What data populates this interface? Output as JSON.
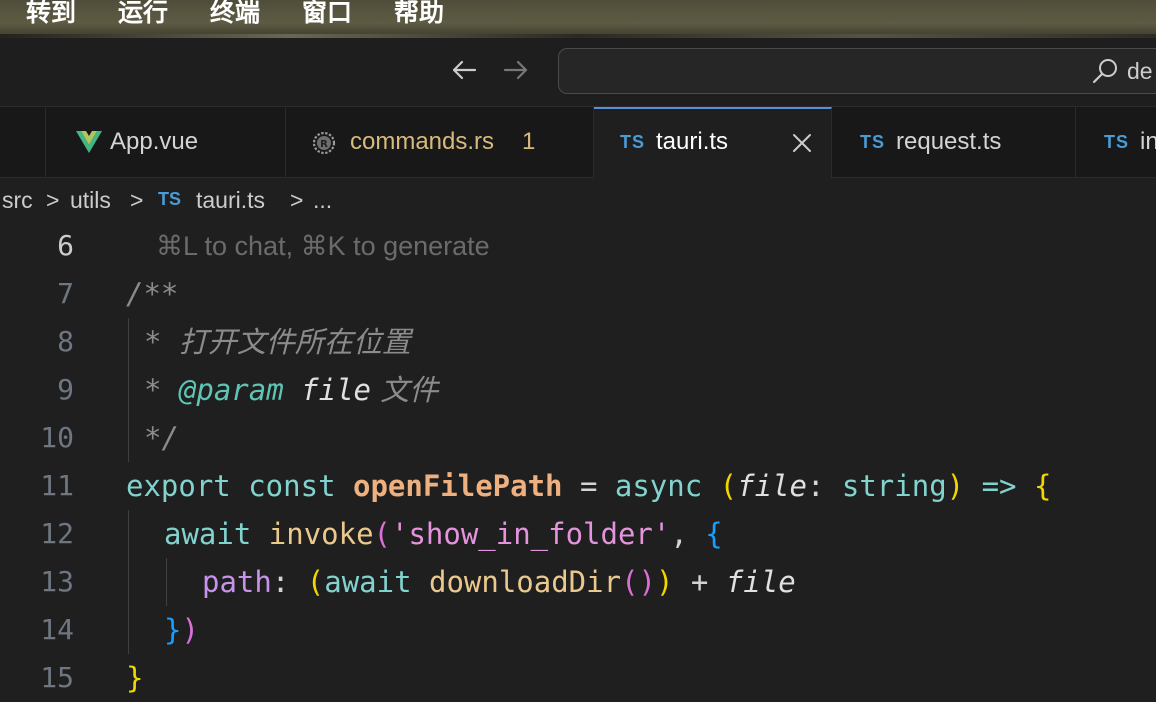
{
  "menu": {
    "items": [
      "转到",
      "运行",
      "终端",
      "窗口",
      "帮助"
    ]
  },
  "titlebar": {
    "search_text": "de"
  },
  "tabs": [
    {
      "label": "App.vue",
      "icon": "vue-icon",
      "badge": ""
    },
    {
      "label": "commands.rs",
      "icon": "rust-icon",
      "badge": "1"
    },
    {
      "label": "tauri.ts",
      "icon": "TS",
      "badge": "",
      "active": true
    },
    {
      "label": "request.ts",
      "icon": "TS",
      "badge": ""
    },
    {
      "label": "in",
      "icon": "TS",
      "badge": ""
    }
  ],
  "breadcrumb": {
    "parts": [
      "src",
      "utils",
      "tauri.ts",
      "..."
    ],
    "ts_label": "TS",
    "sep": ">"
  },
  "editor": {
    "hint": "⌘L to chat, ⌘K to generate",
    "line_numbers": [
      "6",
      "7",
      "8",
      "9",
      "10",
      "11",
      "12",
      "13",
      "14",
      "15"
    ],
    "lines": {
      "l7": "/**",
      "l8_star": "* ",
      "l8_text": "打开文件所在位置",
      "l9_star": "* ",
      "l9_tag": "@param",
      "l9_param": " file",
      "l9_text": " 文件",
      "l10": "*/",
      "l11_export": "export",
      "l11_const": " const ",
      "l11_name": "openFilePath",
      "l11_eq": " = ",
      "l11_async": "async",
      "l11_open": " (",
      "l11_param": "file",
      "l11_colon": ": ",
      "l11_type": "string",
      "l11_close": ")",
      "l11_arrow": " => ",
      "l11_brace": "{",
      "l12_await": "await",
      "l12_invoke": " invoke",
      "l12_open": "(",
      "l12_str": "'show_in_folder'",
      "l12_comma": ", ",
      "l12_brace": "{",
      "l13_prop": "path",
      "l13_colon": ": ",
      "l13_open": "(",
      "l13_await": "await",
      "l13_call": " downloadDir",
      "l13_callparens": "()",
      "l13_close": ")",
      "l13_plus": " + ",
      "l13_file": "file",
      "l14_brace": "}",
      "l14_paren": ")",
      "l15": "}"
    }
  },
  "colors": {
    "accent": "#5a8fd8",
    "commands_tab_text": "#d7ba7d"
  }
}
